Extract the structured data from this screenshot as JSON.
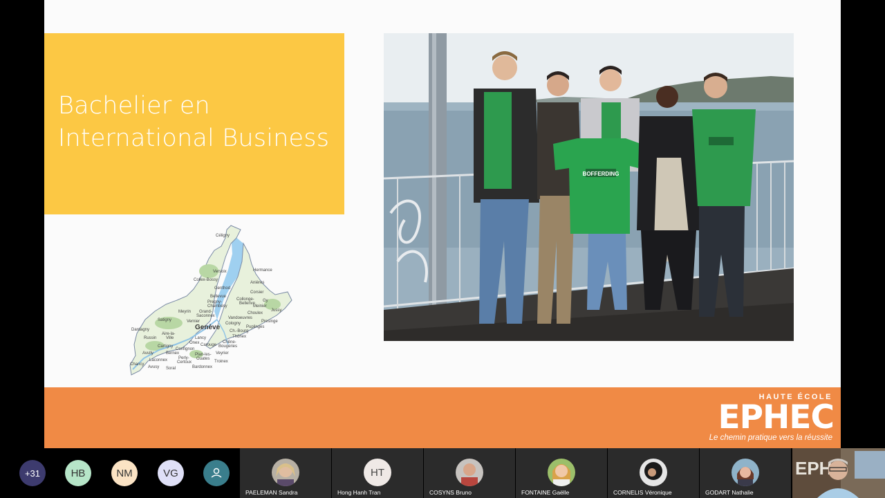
{
  "slide": {
    "title_line1": "Bachelier en",
    "title_line2": "International Business",
    "map": {
      "city_main": "Genève",
      "places": [
        "Céligny",
        "Versoix",
        "Hermance",
        "Collex-Bossy",
        "Genthod",
        "Anières",
        "Bellevue",
        "Corsier",
        "Pregny-Chambésy",
        "Collonge-Bellerive",
        "Gy",
        "Meyrin",
        "Grand-Saconnex",
        "Meinier",
        "Satigny",
        "Vernier",
        "Choulex",
        "Jussy",
        "Dardagny",
        "Cologny",
        "Vandoeuvres",
        "Presinge",
        "Russin",
        "Aire-la-Ville",
        "Ch.-Bourg",
        "Puplinges",
        "Thônex",
        "Lancy",
        "Onex",
        "Chêne-Bougeries",
        "Cartigny",
        "Confignon",
        "Carouge",
        "Avully",
        "Bernex",
        "Plan-les-Ouates",
        "Veyrier",
        "Perly-Certoux",
        "Laconnex",
        "Troinex",
        "Chancy",
        "Avusy",
        "Soral",
        "Bardonnex"
      ]
    },
    "photo": {
      "shirt_text": "BOFFERDING"
    },
    "footer": {
      "school_top": "HAUTE ÉCOLE",
      "logo": "EPHEC",
      "tagline": "Le chemin pratique vers la réussite",
      "color": "#f08a45"
    },
    "title_box_color": "#fcc844"
  },
  "participants": {
    "overflow_count": "+31",
    "avatars": [
      {
        "initials": "HB",
        "color": "#b6e5c8"
      },
      {
        "initials": "NM",
        "color": "#fbe3c4"
      },
      {
        "initials": "VG",
        "color": "#dfe0f7"
      },
      {
        "icon": "person-icon",
        "color": "#3a7e8c"
      }
    ],
    "tiles": [
      {
        "name": "PAELEMAN Sandra"
      },
      {
        "name": "Hong Hanh Tran",
        "initials": "HT"
      },
      {
        "name": "COSYNS Bruno"
      },
      {
        "name": "FONTAINE Gaëlle"
      },
      {
        "name": "CORNELIS Véronique"
      },
      {
        "name": "GODART Nathalie"
      }
    ]
  }
}
